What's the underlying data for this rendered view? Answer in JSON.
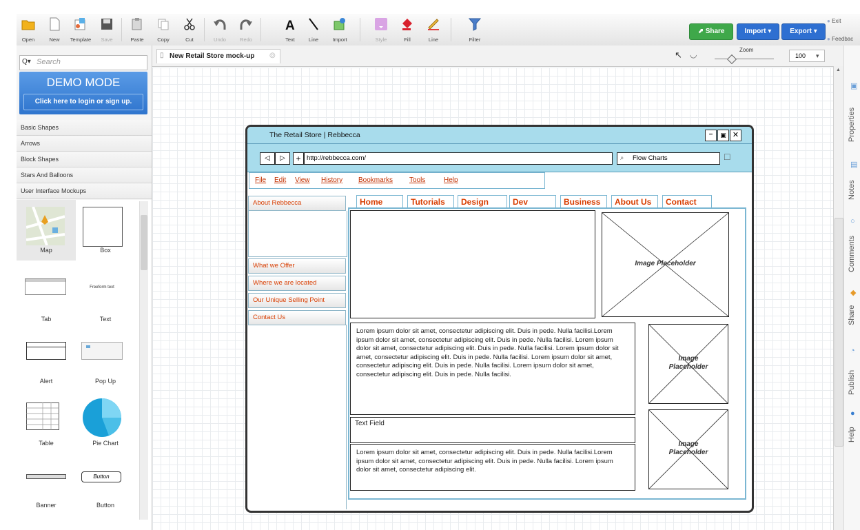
{
  "toolbar": {
    "buttons": [
      {
        "label": "Open",
        "enabled": true
      },
      {
        "label": "New",
        "enabled": true
      },
      {
        "label": "Template",
        "enabled": true
      },
      {
        "label": "Save",
        "enabled": false
      },
      {
        "label": "Paste",
        "enabled": true
      },
      {
        "label": "Copy",
        "enabled": true
      },
      {
        "label": "Cut",
        "enabled": true
      },
      {
        "label": "Undo",
        "enabled": false
      },
      {
        "label": "Redo",
        "enabled": false
      },
      {
        "label": "Text",
        "enabled": true
      },
      {
        "label": "Line",
        "enabled": true
      },
      {
        "label": "Import",
        "enabled": true
      },
      {
        "label": "Style",
        "enabled": false
      },
      {
        "label": "Fill",
        "enabled": true
      },
      {
        "label": "Line",
        "enabled": true
      },
      {
        "label": "Filter",
        "enabled": true
      }
    ],
    "share_label": "Share",
    "import_label": "Import",
    "export_label": "Export",
    "exit_label": "Exit",
    "feedback_label": "Feedbac",
    "colors": {
      "share": "#3fa84a",
      "import": "#2e6fd1",
      "export": "#2e6fd1"
    }
  },
  "sidebar": {
    "search_placeholder": "Search",
    "demo_title": "DEMO MODE",
    "demo_button": "Click here to login or sign up.",
    "categories": [
      "Basic Shapes",
      "Arrows",
      "Block Shapes",
      "Stars And Balloons",
      "User Interface Mockups"
    ],
    "shapes": [
      "Map",
      "Box",
      "Tab",
      "Text",
      "Alert",
      "Pop Up",
      "Table",
      "Pie Chart",
      "Banner",
      "Button"
    ],
    "text_shape_preview": "Freeform text",
    "button_shape_preview": "Button"
  },
  "document": {
    "tab_title": "New Retail Store mock-up",
    "zoom_label": "Zoom",
    "zoom_value": "100"
  },
  "right_tabs": [
    "Properties",
    "Notes",
    "Comments",
    "Share",
    "Publish",
    "Help"
  ],
  "mockup": {
    "window_title": "The Retail Store | Rebbecca",
    "url": "http://rebbecca.com/",
    "search_text": "Flow Charts",
    "menu": [
      "File",
      "Edit",
      "View",
      "History",
      "Bookmarks",
      "Tools",
      "Help"
    ],
    "tabs": [
      "Home",
      "Tutorials",
      "Design",
      "Dev",
      "Business",
      "About Us",
      "Contact"
    ],
    "side_header": "About Rebbecca",
    "side_links": [
      "What we Offer",
      "Where we are located",
      "Our Unique Selling Point",
      "Contact Us"
    ],
    "image_placeholder": "Image Placeholder",
    "image_placeholder_line1": "Image",
    "image_placeholder_line2": "Placeholder",
    "paragraph1": "Lorem ipsum dolor sit amet, consectetur adipiscing elit. Duis in pede. Nulla facilisi.Lorem ipsum dolor sit amet, consectetur adipiscing elit. Duis in pede. Nulla facilisi. Lorem ipsum dolor sit amet, consectetur adipiscing elit. Duis in pede. Nulla facilisi. Lorem ipsum dolor sit amet, consectetur adipiscing elit. Duis in pede. Nulla facilisi. Lorem ipsum dolor sit amet, consectetur adipiscing elit. Duis in pede. Nulla facilisi. Lorem ipsum dolor sit amet, consectetur adipiscing elit. Duis in pede. Nulla facilisi.",
    "text_field": "Text Field",
    "paragraph2": "Lorem ipsum dolor sit amet, consectetur adipiscing elit. Duis in pede. Nulla facilisi.Lorem ipsum dolor sit amet, consectetur adipiscing elit. Duis in pede. Nulla facilisi. Lorem ipsum dolor sit amet, consectetur adipiscing elit."
  }
}
